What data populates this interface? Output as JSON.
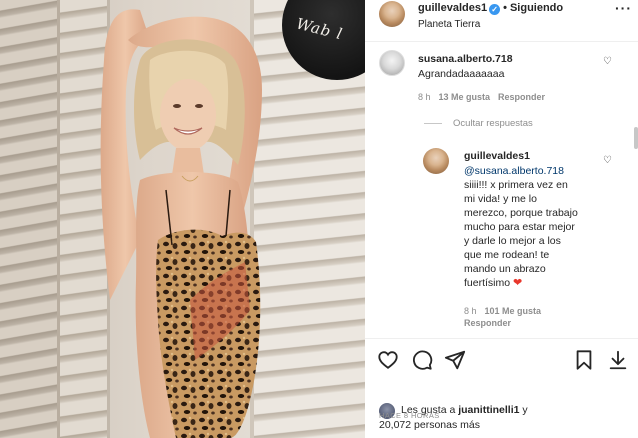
{
  "header": {
    "username": "guillevaldes1",
    "verified_mark": "✓",
    "separator": "•",
    "follow_status": "Siguiendo",
    "location": "Planeta Tierra",
    "more_icon": "more-options-icon",
    "more_glyph": "···"
  },
  "photo": {
    "hat_text": "Wab l"
  },
  "comments": [
    {
      "username": "susana.alberto.718",
      "text": "Agrandadaaaaaaa",
      "time": "8 h",
      "likes": "13 Me gusta",
      "reply_label": "Responder"
    }
  ],
  "hide_replies_label": "Ocultar respuestas",
  "reply": {
    "username": "guillevaldes1",
    "mention": "@susana.alberto.718",
    "lines": [
      "siiii!!! x primera vez en",
      "mi vida! y me lo",
      "merezco, porque trabajo",
      "mucho para estar mejor",
      "y darle lo mejor a los",
      "que me rodean! te",
      "mando un abrazo",
      "fuertísimo"
    ],
    "heart_emoji": "❤",
    "time": "8 h",
    "likes": "101 Me gusta",
    "reply_label": "Responder"
  },
  "actions": {
    "icons": [
      "heart-icon",
      "comment-icon",
      "share-icon",
      "bookmark-icon",
      "download-icon"
    ]
  },
  "likes": {
    "prefix": "Les gusta a ",
    "user": "juanittinelli1",
    "suffix": " y",
    "count": "20,072 personas más"
  },
  "time_ago": "HACE 8 HORAS",
  "colors": {
    "link": "#00376b",
    "verified": "#3897f0",
    "muted": "#8e8e8e",
    "text": "#262626"
  }
}
